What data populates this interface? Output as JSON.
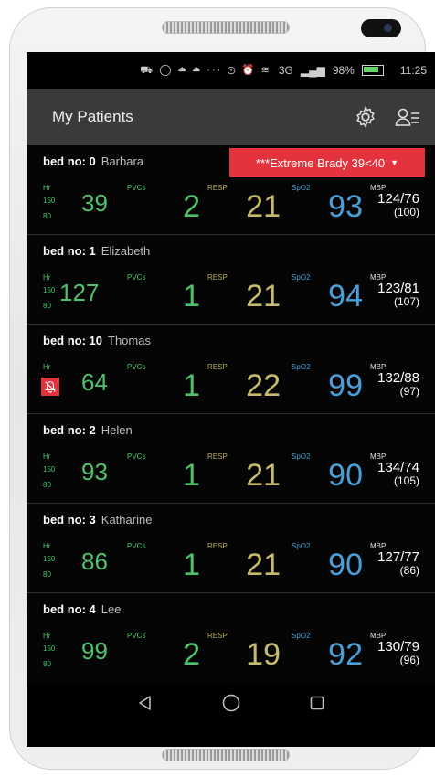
{
  "status_bar": {
    "battery": "98%",
    "time": "11:25",
    "signal": "3G"
  },
  "app_bar": {
    "title": "My Patients"
  },
  "labels": {
    "hr": "Hr",
    "pvcs": "PVCs",
    "resp": "RESP",
    "spo2": "SpO2",
    "mbp": "MBP"
  },
  "patients": [
    {
      "bed": "bed no: 0",
      "name": "Barbara",
      "alarm": "***Extreme Brady  39<40",
      "hr_hi": "150",
      "hr_lo": "80",
      "hr": "39",
      "pvcs": "2",
      "resp": "21",
      "spo2": "93",
      "mbp": "124/76",
      "mbp_mean": "(100)"
    },
    {
      "bed": "bed no: 1",
      "name": "Elizabeth",
      "hr_hi": "150",
      "hr_lo": "80",
      "hr": "127",
      "pvcs": "1",
      "resp": "21",
      "spo2": "94",
      "mbp": "123/81",
      "mbp_mean": "(107)"
    },
    {
      "bed": "bed no: 10",
      "name": "Thomas",
      "hr_alarm_off": true,
      "hr": "64",
      "pvcs": "1",
      "resp": "22",
      "spo2": "99",
      "mbp": "132/88",
      "mbp_mean": "(97)"
    },
    {
      "bed": "bed no: 2",
      "name": "Helen",
      "hr_hi": "150",
      "hr_lo": "80",
      "hr": "93",
      "pvcs": "1",
      "resp": "21",
      "spo2": "90",
      "mbp": "134/74",
      "mbp_mean": "(105)"
    },
    {
      "bed": "bed no: 3",
      "name": "Katharine",
      "hr_hi": "150",
      "hr_lo": "80",
      "hr": "86",
      "pvcs": "1",
      "resp": "21",
      "spo2": "90",
      "mbp": "127/77",
      "mbp_mean": "(86)"
    },
    {
      "bed": "bed no: 4",
      "name": "Lee",
      "hr_hi": "150",
      "hr_lo": "80",
      "hr": "99",
      "pvcs": "2",
      "resp": "19",
      "spo2": "92",
      "mbp": "130/79",
      "mbp_mean": "(96)"
    }
  ],
  "colors": {
    "hr": "#4fc16a",
    "resp": "#c6bb6d",
    "spo2": "#4a9fd8",
    "alarm": "#e5333e",
    "app_bar": "#3a3a3a"
  },
  "icons": {
    "settings": "gear-icon",
    "users": "user-list-icon",
    "alarm_off": "bell-off-icon",
    "back": "back-triangle-icon",
    "home": "home-circle-icon",
    "recents": "recents-square-icon"
  }
}
